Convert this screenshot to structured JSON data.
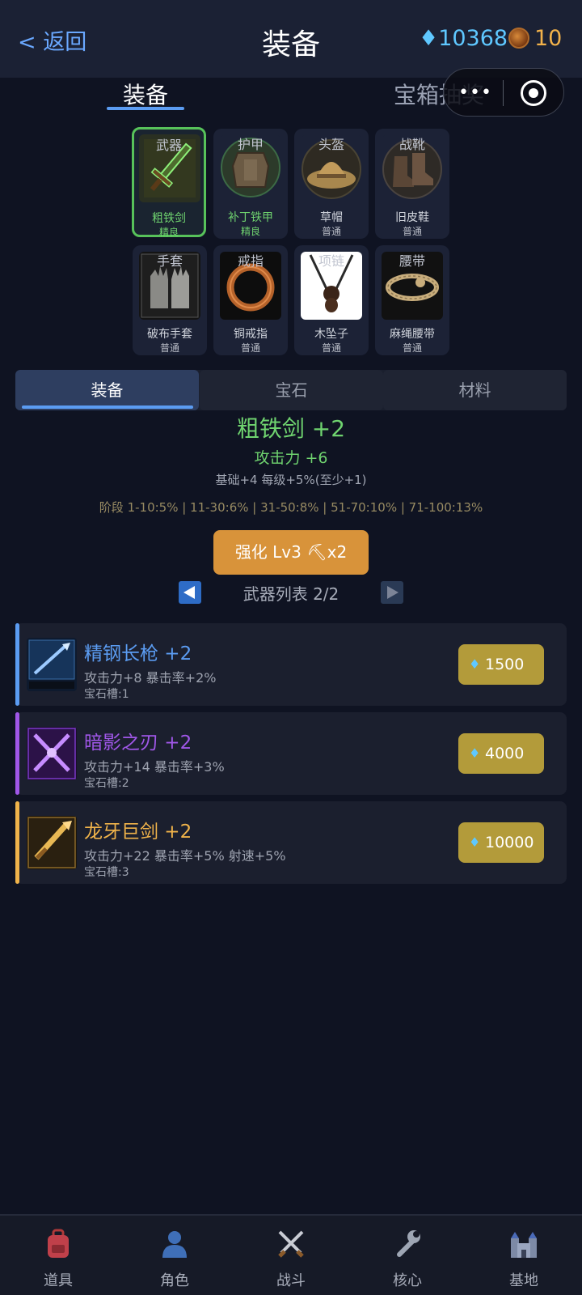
{
  "header": {
    "back_label": "< 返回",
    "title": "装备",
    "gems": "♦10368",
    "coins": "10"
  },
  "top_tabs": [
    {
      "label": "装备",
      "active": true
    },
    {
      "label": "宝箱抽奖",
      "active": false
    }
  ],
  "capsule": {
    "more_glyph": "•••"
  },
  "equip_slots": [
    {
      "slot": "武器",
      "name": "粗铁剑",
      "rarity": "精良",
      "selected": true,
      "icon": "sword-icon"
    },
    {
      "slot": "护甲",
      "name": "补丁铁甲",
      "rarity": "精良",
      "selected": false,
      "icon": "armor-icon"
    },
    {
      "slot": "头盔",
      "name": "草帽",
      "rarity": "普通",
      "selected": false,
      "icon": "helmet-icon"
    },
    {
      "slot": "战靴",
      "name": "旧皮鞋",
      "rarity": "普通",
      "selected": false,
      "icon": "boots-icon"
    },
    {
      "slot": "手套",
      "name": "破布手套",
      "rarity": "普通",
      "selected": false,
      "icon": "gloves-icon"
    },
    {
      "slot": "戒指",
      "name": "铜戒指",
      "rarity": "普通",
      "selected": false,
      "icon": "ring-icon"
    },
    {
      "slot": "项链",
      "name": "木坠子",
      "rarity": "普通",
      "selected": false,
      "icon": "necklace-icon"
    },
    {
      "slot": "腰带",
      "name": "麻绳腰带",
      "rarity": "普通",
      "selected": false,
      "icon": "belt-icon"
    }
  ],
  "sub_tabs": [
    {
      "label": "装备",
      "active": true
    },
    {
      "label": "宝石",
      "active": false
    },
    {
      "label": "材料",
      "active": false
    }
  ],
  "detail": {
    "title": "粗铁剑 +2",
    "attack": "攻击力 +6",
    "base_info": "基础+4  每级+5%(至少+1)",
    "stages": "阶段 1-10:5% | 11-30:6% | 31-50:8% | 51-70:10% | 71-100:13%"
  },
  "upgrade_button": "强化 Lv3 ⛏x2",
  "weapon_list_label": "武器列表 2/2",
  "weapon_list": [
    {
      "name": "精钢长枪 +2",
      "stats": "攻击力+8   暴击率+2%",
      "slot_info": "宝石槽:1",
      "price": "1500",
      "color": "#5b9cf2",
      "icon": "spear-icon"
    },
    {
      "name": "暗影之刃 +2",
      "stats": "攻击力+14   暴击率+3%",
      "slot_info": "宝石槽:2",
      "price": "4000",
      "color": "#a057e8",
      "icon": "shadow-blade-icon"
    },
    {
      "name": "龙牙巨剑 +2",
      "stats": "攻击力+22   暴击率+5%   射速+5%",
      "slot_info": "宝石槽:3",
      "price": "10000",
      "color": "#f0b34a",
      "icon": "dragon-sword-icon"
    }
  ],
  "bottom_nav": [
    {
      "label": "道具",
      "icon": "backpack-icon"
    },
    {
      "label": "角色",
      "icon": "person-icon"
    },
    {
      "label": "战斗",
      "icon": "crossed-swords-icon"
    },
    {
      "label": "核心",
      "icon": "wrench-icon"
    },
    {
      "label": "基地",
      "icon": "castle-icon"
    }
  ]
}
